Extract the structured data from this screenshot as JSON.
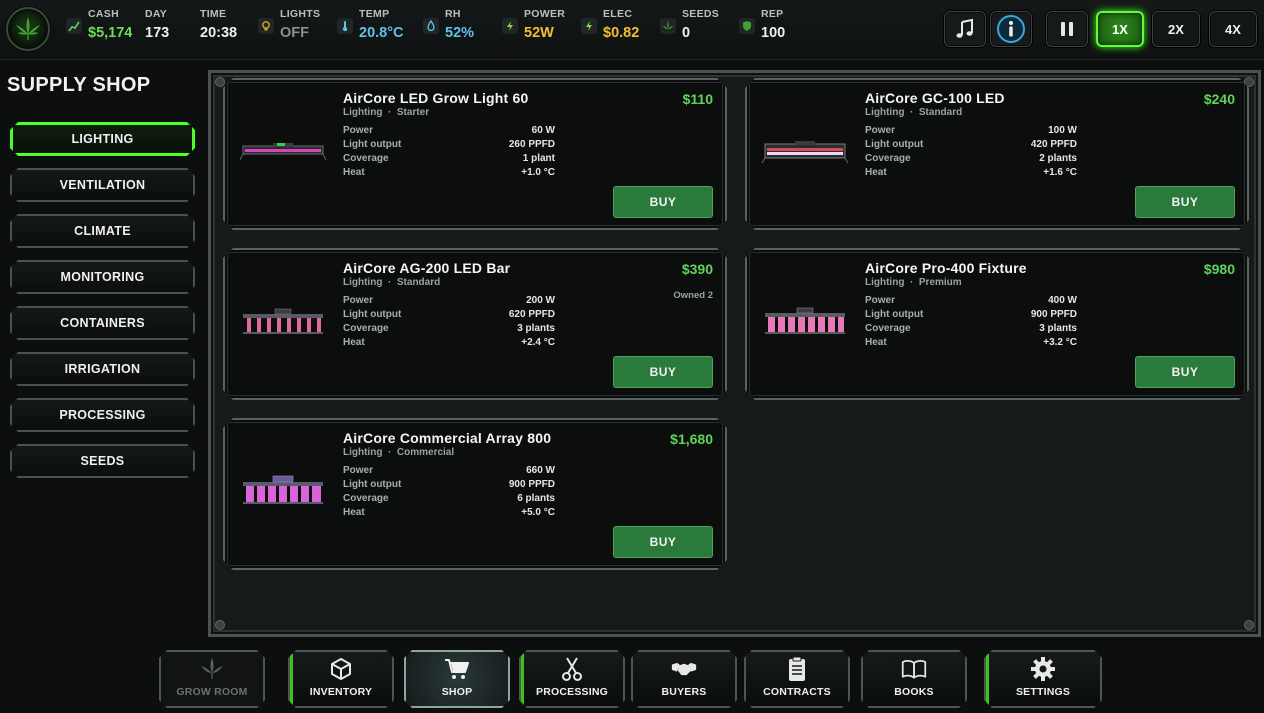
{
  "topbar": {
    "stats": [
      {
        "label": "CASH",
        "value": "$5,174",
        "color": "#6bdc5a",
        "icon": "cash-chart-icon"
      },
      {
        "label": "DAY",
        "value": "173",
        "color": "#f0f0f0",
        "icon": ""
      },
      {
        "label": "TIME",
        "value": "20:38",
        "color": "#f0f0f0",
        "icon": ""
      },
      {
        "label": "LIGHTS",
        "value": "OFF",
        "color": "#8a9090",
        "icon": "lightbulb-icon"
      },
      {
        "label": "TEMP",
        "value": "20.8°C",
        "color": "#5ec2ea",
        "icon": "thermometer-icon"
      },
      {
        "label": "RH",
        "value": "52%",
        "color": "#5ec2ea",
        "icon": "droplet-icon"
      },
      {
        "label": "POWER",
        "value": "52W",
        "color": "#f0c030",
        "icon": "bolt-icon"
      },
      {
        "label": "ELEC",
        "value": "$0.82",
        "color": "#f0c030",
        "icon": "bolt-icon"
      },
      {
        "label": "SEEDS",
        "value": "0",
        "color": "#f0f0f0",
        "icon": "leaf-icon"
      },
      {
        "label": "REP",
        "value": "100",
        "color": "#f0f0f0",
        "icon": "shield-icon"
      }
    ],
    "speeds": [
      "1X",
      "2X",
      "4X"
    ]
  },
  "sidebar": {
    "title": "SUPPLY SHOP",
    "categories": [
      "LIGHTING",
      "VENTILATION",
      "CLIMATE",
      "MONITORING",
      "CONTAINERS",
      "IRRIGATION",
      "PROCESSING",
      "SEEDS"
    ],
    "active": "LIGHTING"
  },
  "products": [
    {
      "name": "AirCore LED Grow Light 60",
      "category": "Lighting",
      "tier": "Starter",
      "price": "$110",
      "owned": "",
      "specs": [
        {
          "k": "Power",
          "v": "60 W"
        },
        {
          "k": "Light output",
          "v": "260 PPFD"
        },
        {
          "k": "Coverage",
          "v": "1 plant"
        },
        {
          "k": "Heat",
          "v": "+1.0 °C"
        }
      ],
      "buy_label": "BUY"
    },
    {
      "name": "AirCore GC-100 LED",
      "category": "Lighting",
      "tier": "Standard",
      "price": "$240",
      "owned": "",
      "specs": [
        {
          "k": "Power",
          "v": "100 W"
        },
        {
          "k": "Light output",
          "v": "420 PPFD"
        },
        {
          "k": "Coverage",
          "v": "2 plants"
        },
        {
          "k": "Heat",
          "v": "+1.6 °C"
        }
      ],
      "buy_label": "BUY"
    },
    {
      "name": "AirCore AG-200 LED Bar",
      "category": "Lighting",
      "tier": "Standard",
      "price": "$390",
      "owned": "Owned 2",
      "specs": [
        {
          "k": "Power",
          "v": "200 W"
        },
        {
          "k": "Light output",
          "v": "620 PPFD"
        },
        {
          "k": "Coverage",
          "v": "3 plants"
        },
        {
          "k": "Heat",
          "v": "+2.4 °C"
        }
      ],
      "buy_label": "BUY"
    },
    {
      "name": "AirCore Pro-400 Fixture",
      "category": "Lighting",
      "tier": "Premium",
      "price": "$980",
      "owned": "",
      "specs": [
        {
          "k": "Power",
          "v": "400 W"
        },
        {
          "k": "Light output",
          "v": "900 PPFD"
        },
        {
          "k": "Coverage",
          "v": "3 plants"
        },
        {
          "k": "Heat",
          "v": "+3.2 °C"
        }
      ],
      "buy_label": "BUY"
    },
    {
      "name": "AirCore Commercial Array 800",
      "category": "Lighting",
      "tier": "Commercial",
      "price": "$1,680",
      "owned": "",
      "specs": [
        {
          "k": "Power",
          "v": "660 W"
        },
        {
          "k": "Light output",
          "v": "900 PPFD"
        },
        {
          "k": "Coverage",
          "v": "6 plants"
        },
        {
          "k": "Heat",
          "v": "+5.0 °C"
        }
      ],
      "buy_label": "BUY"
    }
  ],
  "bottom_nav": [
    {
      "label": "GROW ROOM",
      "icon": "cannabis-leaf-icon",
      "state": "disabled"
    },
    {
      "label": "INVENTORY",
      "icon": "box-icon",
      "state": "normal"
    },
    {
      "label": "SHOP",
      "icon": "cart-icon",
      "state": "active"
    },
    {
      "label": "PROCESSING",
      "icon": "scissors-icon",
      "state": "normal"
    },
    {
      "label": "BUYERS",
      "icon": "handshake-icon",
      "state": "normal"
    },
    {
      "label": "CONTRACTS",
      "icon": "clipboard-icon",
      "state": "normal"
    },
    {
      "label": "BOOKS",
      "icon": "book-icon",
      "state": "normal"
    },
    {
      "label": "SETTINGS",
      "icon": "gear-icon",
      "state": "normal"
    }
  ],
  "colors": {
    "accent_green": "#4bff2a",
    "price_green": "#5fd35b",
    "buy_button": "#2a7a3c",
    "water_blue": "#5ec2ea",
    "power_yellow": "#f0c030"
  }
}
